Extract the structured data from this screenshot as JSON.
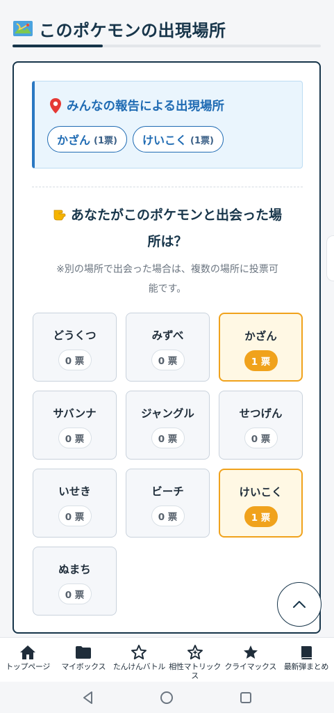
{
  "section": {
    "title": "このポケモンの出現場所",
    "icon": "map-icon"
  },
  "report": {
    "title": "みんなの報告による出現場所",
    "icon": "pin-icon",
    "tags": [
      {
        "name": "かざん",
        "count": "(1票)"
      },
      {
        "name": "けいこく",
        "count": "(1票)"
      }
    ]
  },
  "question": {
    "icon": "pointing-hand-icon",
    "line1": "あなたがこのポケモンと出会った場",
    "line2": "所は？"
  },
  "note": {
    "line1": "※別の場所で出会った場合は、複数の場所に投票可",
    "line2": "能です。"
  },
  "locations": [
    {
      "name": "どうくつ",
      "votes": "0 票",
      "voted": false
    },
    {
      "name": "みずべ",
      "votes": "0 票",
      "voted": false
    },
    {
      "name": "かざん",
      "votes": "1 票",
      "voted": true
    },
    {
      "name": "サバンナ",
      "votes": "0 票",
      "voted": false
    },
    {
      "name": "ジャングル",
      "votes": "0 票",
      "voted": false
    },
    {
      "name": "せつげん",
      "votes": "0 票",
      "voted": false
    },
    {
      "name": "いせき",
      "votes": "0 票",
      "voted": false
    },
    {
      "name": "ビーチ",
      "votes": "0 票",
      "voted": false
    },
    {
      "name": "けいこく",
      "votes": "1 票",
      "voted": true
    },
    {
      "name": "ぬまち",
      "votes": "0 票",
      "voted": false
    }
  ],
  "colors": {
    "accent": "#17354a",
    "report_blue": "#1f6bb3",
    "voted_orange": "#f0a21c"
  },
  "bottom_nav": [
    {
      "label": "トップページ",
      "icon": "home-icon"
    },
    {
      "label": "マイボックス",
      "icon": "folder-icon"
    },
    {
      "label": "たんけんバトル",
      "icon": "star-outline-icon"
    },
    {
      "label": "相性マトリックス",
      "icon": "star-sparkle-icon"
    },
    {
      "label": "クライマックス",
      "icon": "star-filled-icon"
    },
    {
      "label": "最新弾まとめ",
      "icon": "book-icon"
    }
  ],
  "system_bar": [
    "back-icon",
    "home-circle-icon",
    "recents-icon"
  ]
}
